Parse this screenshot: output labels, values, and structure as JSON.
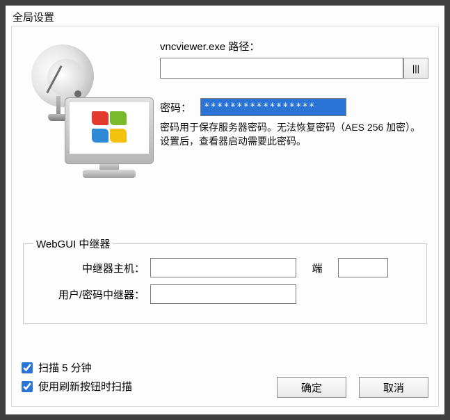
{
  "title": "全局设置",
  "path": {
    "label": "vncviewer.exe 路径：",
    "value": "",
    "browse_label": "|||"
  },
  "password": {
    "label": "密码：",
    "value": "*****************",
    "hint": "密码用于保存服务器密码。无法恢复密码（AES 256 加密）。 设置后，查看器启动需要此密码。"
  },
  "repeater": {
    "legend": "WebGUI 中继器",
    "host_label": "中继器主机：",
    "host_value": "",
    "port_label": "端",
    "port_value": "",
    "userpass_label": "用户/密码中继器：",
    "userpass_value": ""
  },
  "options": {
    "scan_5min": "扫描 5 分钟",
    "scan_on_refresh": "使用刷新按钮时扫描"
  },
  "buttons": {
    "ok": "确定",
    "cancel": "取消"
  }
}
